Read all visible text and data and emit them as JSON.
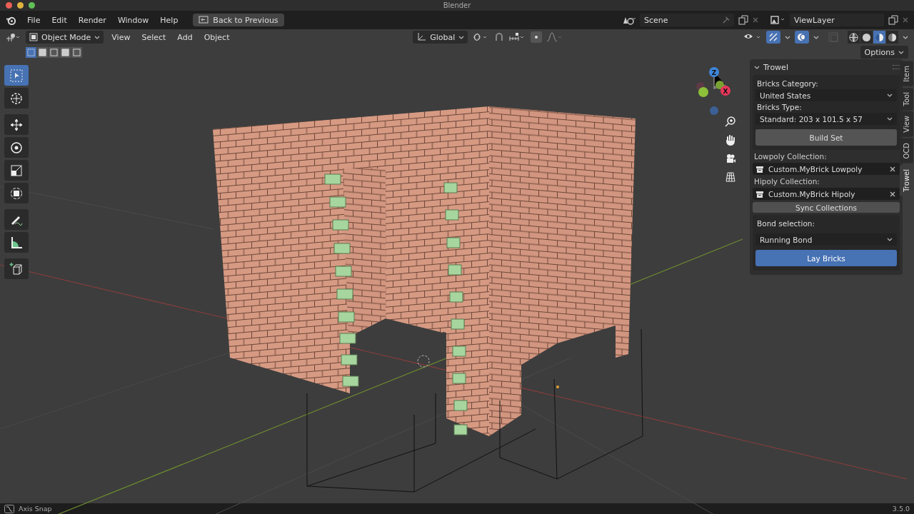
{
  "window": {
    "title": "Blender"
  },
  "topbar": {
    "menus": [
      "File",
      "Edit",
      "Render",
      "Window",
      "Help"
    ],
    "back_button": "Back to Previous",
    "scene": "Scene",
    "view_layer": "ViewLayer"
  },
  "header": {
    "mode": "Object Mode",
    "menus": [
      "View",
      "Select",
      "Add",
      "Object"
    ],
    "orientation": "Global",
    "options": "Options",
    "select_modes": [
      {
        "selected": true
      },
      {
        "selected": false
      },
      {
        "selected": false
      },
      {
        "selected": false
      },
      {
        "selected": false
      }
    ],
    "gizmos_on": true,
    "overlays_on": true,
    "shading": [
      {
        "kind": "wireframe",
        "selected": false
      },
      {
        "kind": "solid",
        "selected": false
      },
      {
        "kind": "material",
        "selected": true
      },
      {
        "kind": "rendered",
        "selected": false
      }
    ]
  },
  "tools": [
    {
      "kind": "select",
      "selected": true
    },
    {
      "kind": "cursor",
      "selected": false
    },
    {
      "kind": "move",
      "selected": false
    },
    {
      "kind": "rotate",
      "selected": false
    },
    {
      "kind": "scale",
      "selected": false
    },
    {
      "kind": "transform",
      "selected": false
    },
    {
      "kind": "annotate",
      "selected": false
    },
    {
      "kind": "measure",
      "selected": false
    },
    {
      "kind": "add-cube",
      "selected": false
    }
  ],
  "gizmo": {
    "z_label": "Z",
    "x_label": "X"
  },
  "panel": {
    "title": "Trowel",
    "bricks_category_label": "Bricks Category:",
    "bricks_category": "United States",
    "bricks_type_label": "Bricks Type:",
    "bricks_type": "Standard: 203 x 101.5 x 57",
    "build_button": "Build Set",
    "lowpoly_label": "Lowpoly Collection:",
    "lowpoly": "Custom.MyBrick Lowpoly",
    "hipoly_label": "Hipoly Collection:",
    "hipoly": "Custom.MyBrick Hipoly",
    "sync_button": "Sync Collections",
    "bond_label": "Bond selection:",
    "bond": "Running Bond",
    "lay_button": "Lay Bricks"
  },
  "sidebar_tabs": [
    {
      "label": "Item",
      "selected": false
    },
    {
      "label": "Tool",
      "selected": false
    },
    {
      "label": "View",
      "selected": false
    },
    {
      "label": "OCD",
      "selected": false
    },
    {
      "label": "Trowel",
      "selected": true
    }
  ],
  "status_bar": {
    "hint": "Axis Snap",
    "version": "3.5.0"
  }
}
